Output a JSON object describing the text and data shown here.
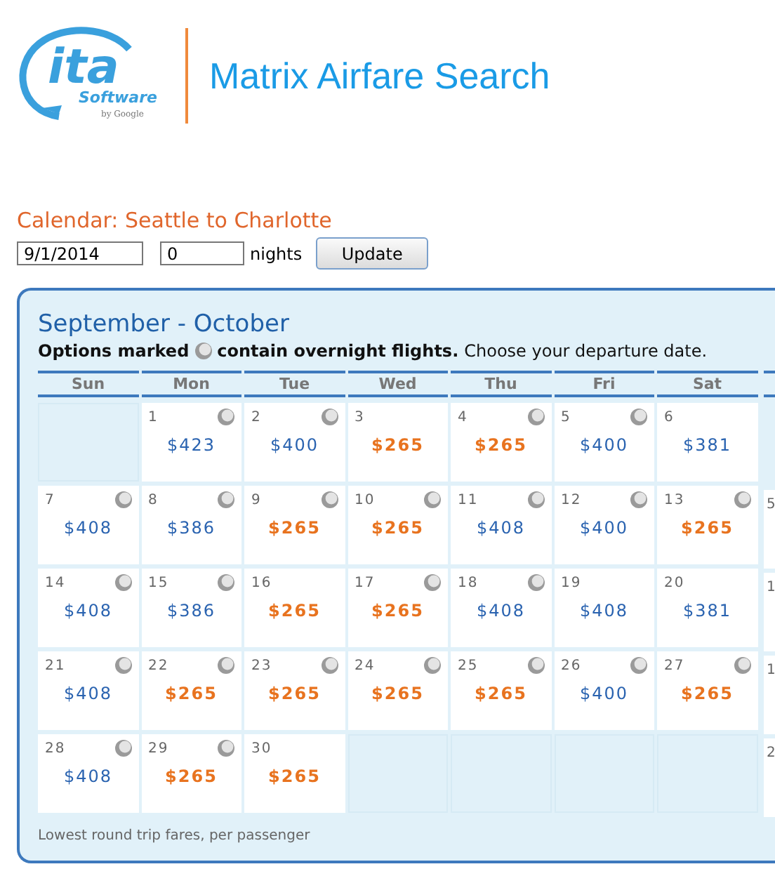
{
  "logo": {
    "mark": "ita",
    "software": "Software",
    "by": "by Google"
  },
  "app_title": "Matrix Airfare Search",
  "calendar_title": "Calendar: Seattle to Charlotte",
  "form": {
    "date": "9/1/2014",
    "nights": "0",
    "nights_label": "nights",
    "button": "Update"
  },
  "panel": {
    "heading": "September - October",
    "note_bold_start": "Options marked",
    "note_bold_end": "contain overnight flights.",
    "note_rest": "Choose your departure date.",
    "footer": "Lowest round trip fares, per passenger"
  },
  "weekdays": [
    "Sun",
    "Mon",
    "Tue",
    "Wed",
    "Thu",
    "Fri",
    "Sat"
  ],
  "weeks": [
    [
      {
        "kind": "blank"
      },
      {
        "day": "1",
        "fare": "$423",
        "overnight": true,
        "cheapest": false
      },
      {
        "day": "2",
        "fare": "$400",
        "overnight": true,
        "cheapest": false
      },
      {
        "day": "3",
        "fare": "$265",
        "overnight": false,
        "cheapest": true
      },
      {
        "day": "4",
        "fare": "$265",
        "overnight": true,
        "cheapest": true
      },
      {
        "day": "5",
        "fare": "$400",
        "overnight": true,
        "cheapest": false
      },
      {
        "day": "6",
        "fare": "$381",
        "overnight": false,
        "cheapest": false
      }
    ],
    [
      {
        "day": "7",
        "fare": "$408",
        "overnight": true,
        "cheapest": false
      },
      {
        "day": "8",
        "fare": "$386",
        "overnight": true,
        "cheapest": false
      },
      {
        "day": "9",
        "fare": "$265",
        "overnight": true,
        "cheapest": true
      },
      {
        "day": "10",
        "fare": "$265",
        "overnight": true,
        "cheapest": true
      },
      {
        "day": "11",
        "fare": "$408",
        "overnight": true,
        "cheapest": false
      },
      {
        "day": "12",
        "fare": "$400",
        "overnight": true,
        "cheapest": false
      },
      {
        "day": "13",
        "fare": "$265",
        "overnight": true,
        "cheapest": true
      }
    ],
    [
      {
        "day": "14",
        "fare": "$408",
        "overnight": true,
        "cheapest": false
      },
      {
        "day": "15",
        "fare": "$386",
        "overnight": true,
        "cheapest": false
      },
      {
        "day": "16",
        "fare": "$265",
        "overnight": false,
        "cheapest": true
      },
      {
        "day": "17",
        "fare": "$265",
        "overnight": true,
        "cheapest": true
      },
      {
        "day": "18",
        "fare": "$408",
        "overnight": true,
        "cheapest": false
      },
      {
        "day": "19",
        "fare": "$408",
        "overnight": false,
        "cheapest": false
      },
      {
        "day": "20",
        "fare": "$381",
        "overnight": false,
        "cheapest": false
      }
    ],
    [
      {
        "day": "21",
        "fare": "$408",
        "overnight": true,
        "cheapest": false
      },
      {
        "day": "22",
        "fare": "$265",
        "overnight": true,
        "cheapest": true
      },
      {
        "day": "23",
        "fare": "$265",
        "overnight": true,
        "cheapest": true
      },
      {
        "day": "24",
        "fare": "$265",
        "overnight": true,
        "cheapest": true
      },
      {
        "day": "25",
        "fare": "$265",
        "overnight": true,
        "cheapest": true
      },
      {
        "day": "26",
        "fare": "$400",
        "overnight": true,
        "cheapest": false
      },
      {
        "day": "27",
        "fare": "$265",
        "overnight": true,
        "cheapest": true
      }
    ],
    [
      {
        "day": "28",
        "fare": "$408",
        "overnight": true,
        "cheapest": false
      },
      {
        "day": "29",
        "fare": "$265",
        "overnight": true,
        "cheapest": true
      },
      {
        "day": "30",
        "fare": "$265",
        "overnight": false,
        "cheapest": true
      },
      {
        "kind": "blank"
      },
      {
        "kind": "blank"
      },
      {
        "kind": "blank"
      },
      {
        "kind": "blank"
      }
    ]
  ],
  "next_month_days": [
    "5",
    "1",
    "1",
    "2"
  ]
}
